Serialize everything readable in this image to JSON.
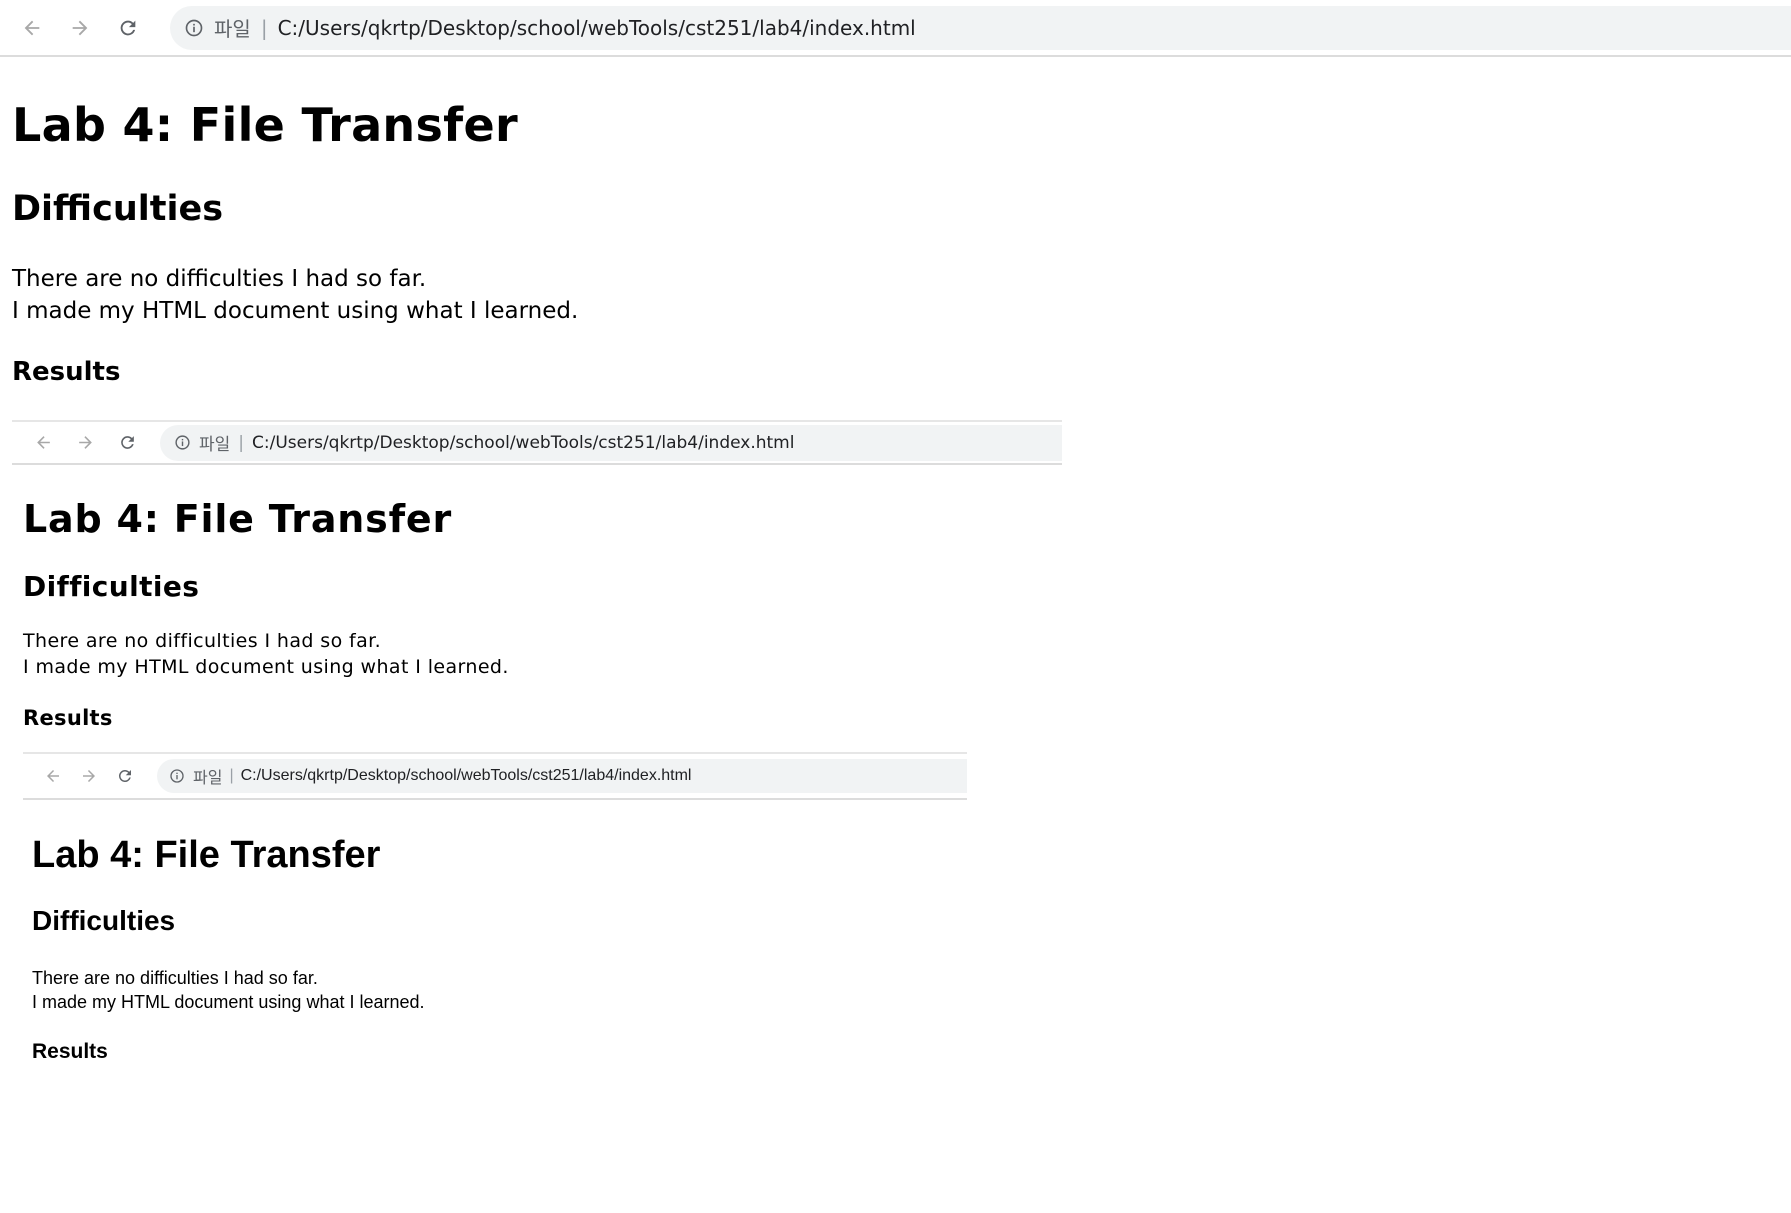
{
  "browser": {
    "scheme_label": "파일",
    "separator": "|",
    "url": "C:/Users/qkrtp/Desktop/school/webTools/cst251/lab4/index.html"
  },
  "icons": {
    "back": "arrow-left",
    "forward": "arrow-right",
    "reload": "reload",
    "info": "info-circle"
  },
  "page": {
    "title": "Lab 4: File Transfer",
    "difficulties_heading": "Difficulties",
    "difficulties_line1": "There are no difficulties I had so far.",
    "difficulties_line2": "I made my HTML document using what I learned.",
    "results_heading": "Results"
  },
  "colors": {
    "toolbar_bg": "#ffffff",
    "omnibox_bg": "#f1f3f4",
    "disabled_nav": "#a8a8a8",
    "icon": "#5f6368",
    "url_text": "#202124"
  }
}
